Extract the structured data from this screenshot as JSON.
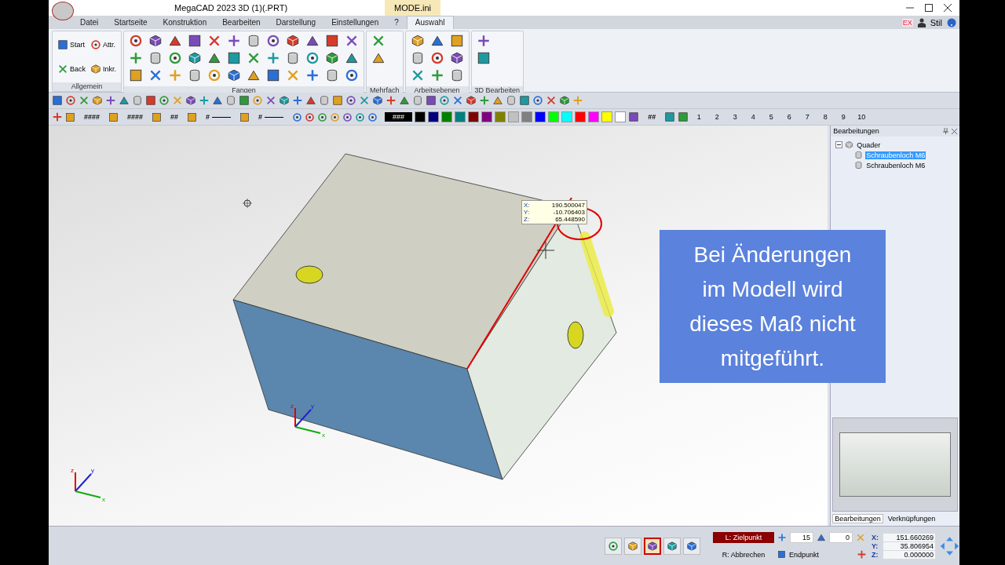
{
  "window": {
    "title": "MegaCAD 2023 3D (1)(.PRT)",
    "context_tab": "MODE.ini"
  },
  "menu_tabs": [
    {
      "label": "Datei",
      "selected": false
    },
    {
      "label": "Startseite",
      "selected": false
    },
    {
      "label": "Konstruktion",
      "selected": false
    },
    {
      "label": "Bearbeiten",
      "selected": false
    },
    {
      "label": "Darstellung",
      "selected": false
    },
    {
      "label": "Einstellungen",
      "selected": false
    },
    {
      "label": "?",
      "selected": false
    },
    {
      "label": "Auswahl",
      "selected": true
    }
  ],
  "menu_right": {
    "badge": "EX",
    "style_label": "Stil"
  },
  "ribbon_groups": [
    {
      "title": "Allgemein",
      "buttons": [
        "Start",
        "Attr.",
        "Back",
        "Inkr."
      ]
    },
    {
      "title": "Fangen"
    },
    {
      "title": "Mehrfach"
    },
    {
      "title": "Arbeitsebenen"
    },
    {
      "title": "3D Bearbeiten"
    }
  ],
  "format_toolbar": {
    "fields": [
      "####",
      "####",
      "##",
      "#",
      "#"
    ],
    "current_color": "###",
    "layer_label": "##"
  },
  "palette": [
    {
      "color": "#000000"
    },
    {
      "color": "#000080"
    },
    {
      "color": "#008000"
    },
    {
      "color": "#008080"
    },
    {
      "color": "#800000"
    },
    {
      "color": "#800080"
    },
    {
      "color": "#808000"
    },
    {
      "color": "#c0c0c0"
    },
    {
      "color": "#808080"
    },
    {
      "color": "#0000ff"
    },
    {
      "color": "#00ff00"
    },
    {
      "color": "#00ffff"
    },
    {
      "color": "#ff0000"
    },
    {
      "color": "#ff00ff"
    },
    {
      "color": "#ffff00"
    },
    {
      "color": "#ffffff"
    }
  ],
  "layers": [
    "1",
    "2",
    "3",
    "4",
    "5",
    "6",
    "7",
    "8",
    "9",
    "10"
  ],
  "viewport": {
    "coordinate_tooltip": [
      {
        "axis": "X:",
        "value": "190.500047"
      },
      {
        "axis": "Y:",
        "value": "-10.706403"
      },
      {
        "axis": "Z:",
        "value": "65.448590"
      }
    ],
    "caption": "Bei Änderungen im Modell wird dieses Maß nicht mitgeführt.",
    "axis_triads": [
      {
        "labels": [
          "z",
          "y",
          "x"
        ]
      },
      {
        "labels": [
          "z",
          "y",
          "x"
        ]
      }
    ]
  },
  "side_panel": {
    "title": "Bearbeitungen",
    "tree": [
      {
        "label": "Quader",
        "expanded": true,
        "selected": false,
        "children": [
          {
            "label": "Schraubenloch M6",
            "selected": true
          },
          {
            "label": "Schraubenloch M6",
            "selected": false
          }
        ]
      }
    ],
    "tabs": [
      {
        "label": "Bearbeitungen",
        "selected": true
      },
      {
        "label": "Verknüpfungen",
        "selected": false
      }
    ]
  },
  "status_bar": {
    "mode_buttons": [
      {
        "selected": false
      },
      {
        "selected": false
      },
      {
        "selected": true
      },
      {
        "selected": false
      },
      {
        "selected": false
      }
    ],
    "prompt_left": "L: Zielpunkt",
    "prompt_right": "R: Abbrechen",
    "angle_step": "15",
    "angle": "0",
    "snap_mode": "Endpunkt",
    "coordinates": [
      {
        "axis": "X:",
        "value": "151.660269"
      },
      {
        "axis": "Y:",
        "value": "35.806954"
      },
      {
        "axis": "Z:",
        "value": "0.000000"
      }
    ]
  }
}
